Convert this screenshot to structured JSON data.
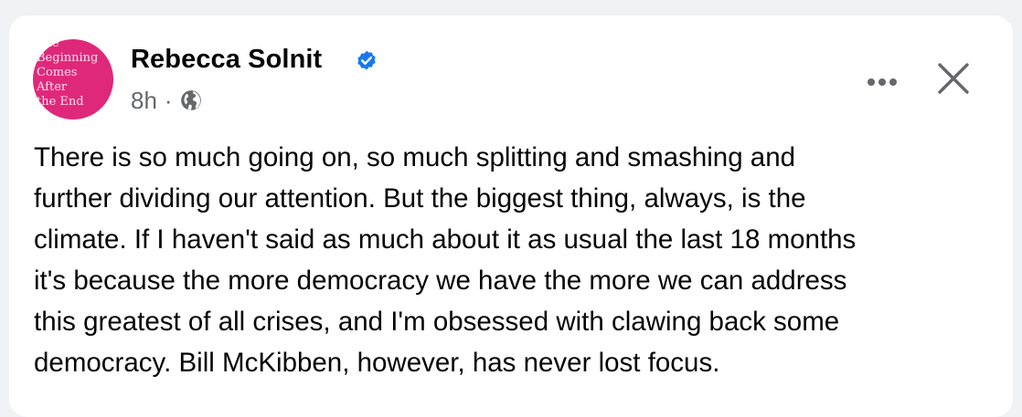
{
  "post": {
    "avatar_lines": [
      "The",
      "Beginning",
      "Comes",
      "After",
      "the End"
    ],
    "author": "Rebecca Solnit",
    "verified": true,
    "timestamp": "8h",
    "separator": "·",
    "audience_icon": "globe-icon",
    "more_icon": "more-options-icon",
    "close_icon": "close-icon",
    "text_lines": [
      "There is so much going on, so much splitting and smashing and",
      "further dividing our attention. But the biggest thing, always, is the",
      "climate. If I haven't said as much about it as usual the last 18 months",
      "it's because the more democracy we have the more we can address",
      "this greatest of all crises, and I'm obsessed with clawing back some",
      "democracy. Bill McKibben, however, has never lost focus."
    ]
  },
  "colors": {
    "page_background": "#f0f2f5",
    "card_background": "#ffffff",
    "avatar_pink": "#e0287a",
    "verified_blue": "#1877f2",
    "secondary_text": "#65676b",
    "primary_text": "#050505"
  }
}
